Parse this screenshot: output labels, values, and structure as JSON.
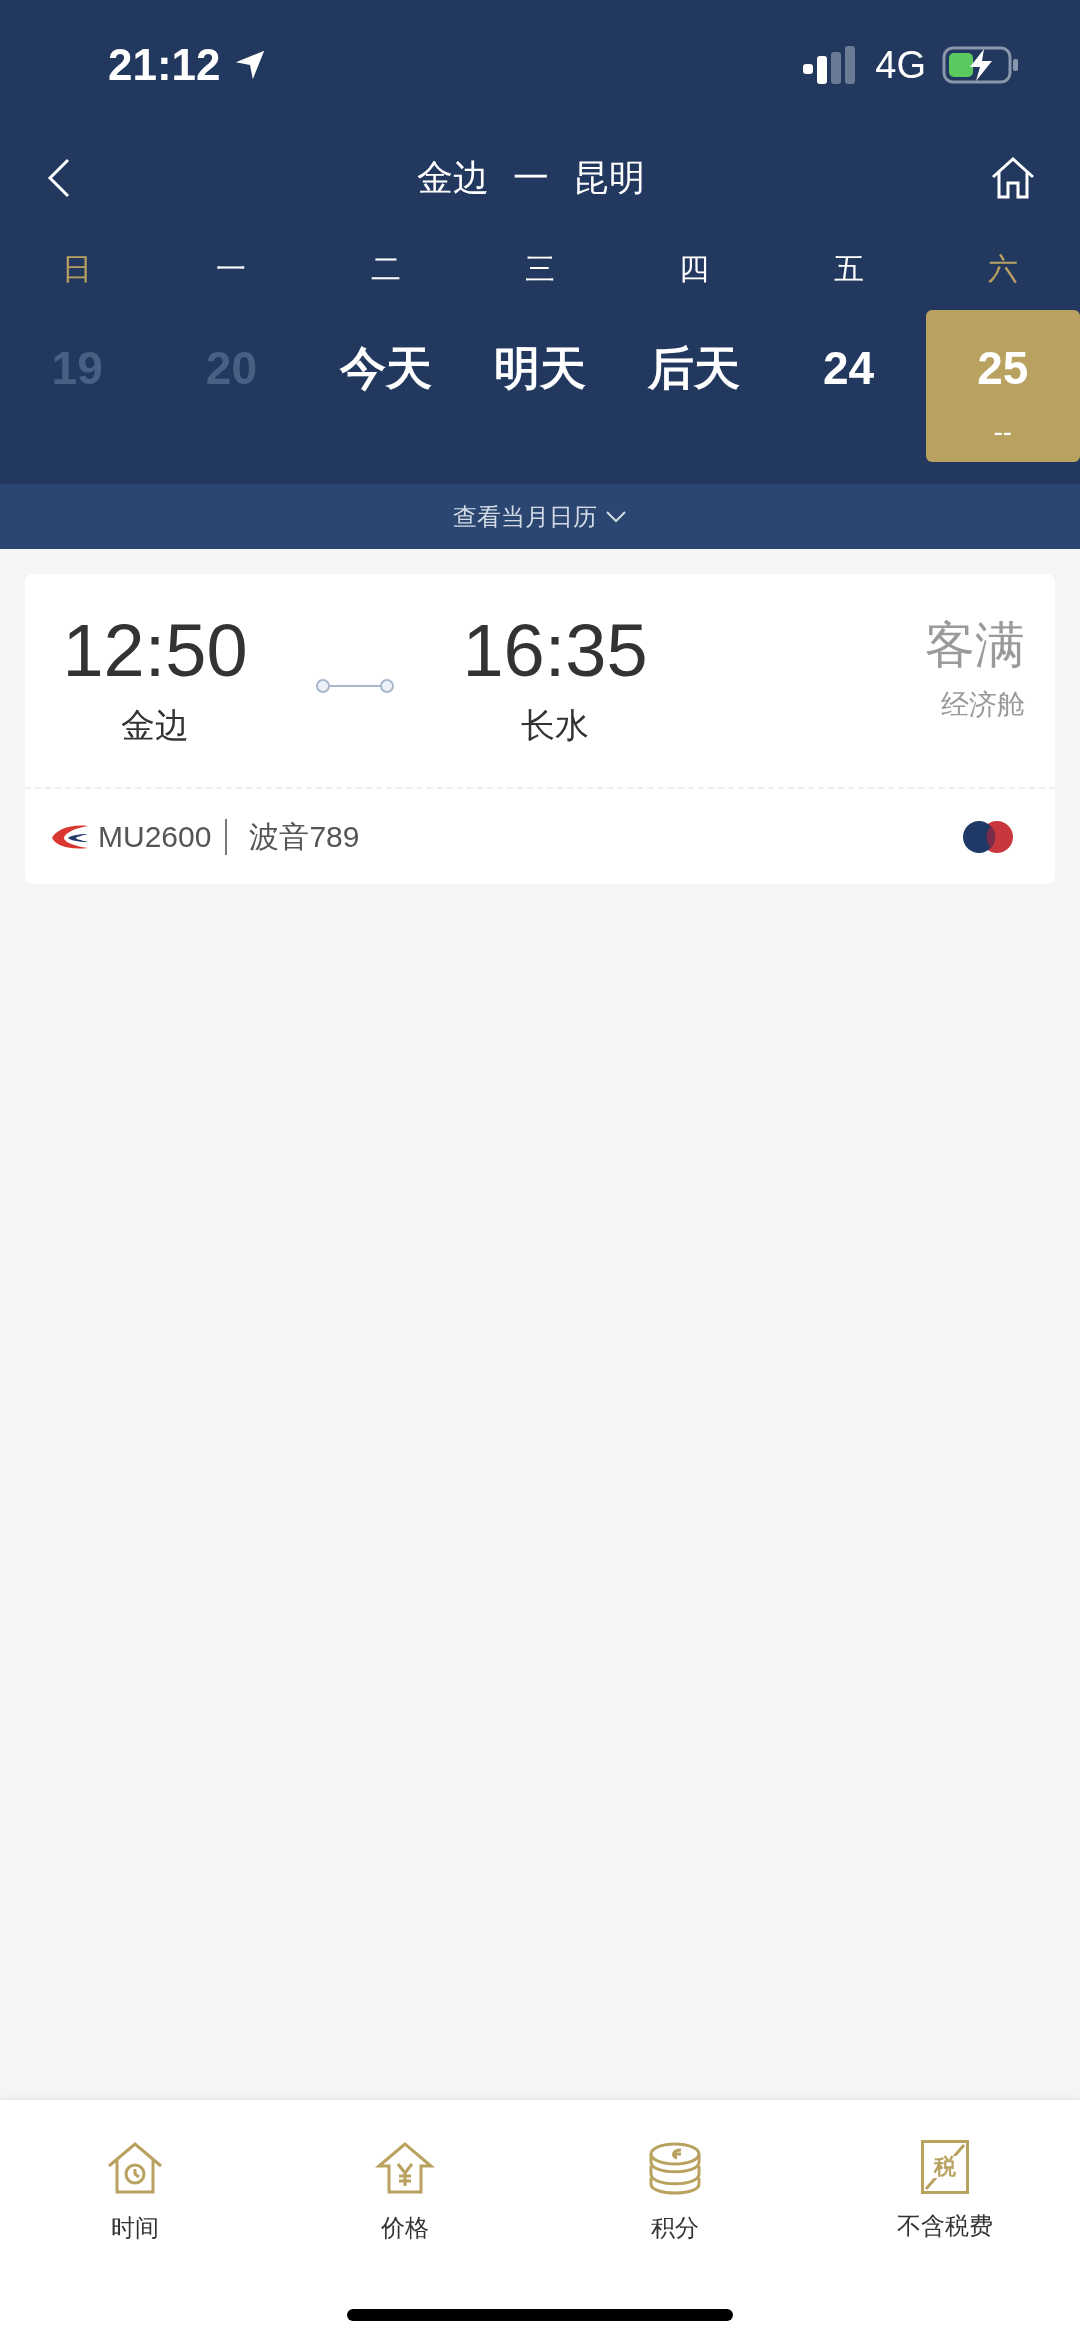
{
  "status_bar": {
    "time": "21:12",
    "network": "4G"
  },
  "header": {
    "title_from": "金边",
    "title_sep": "一",
    "title_to": "昆明"
  },
  "days": [
    {
      "weekday": "日",
      "weekend": true,
      "label": "19",
      "past": true,
      "selected": false
    },
    {
      "weekday": "一",
      "weekend": false,
      "label": "20",
      "past": true,
      "selected": false
    },
    {
      "weekday": "二",
      "weekend": false,
      "label": "今天",
      "past": false,
      "selected": false
    },
    {
      "weekday": "三",
      "weekend": false,
      "label": "明天",
      "past": false,
      "selected": false
    },
    {
      "weekday": "四",
      "weekend": false,
      "label": "后天",
      "past": false,
      "selected": false
    },
    {
      "weekday": "五",
      "weekend": false,
      "label": "24",
      "past": false,
      "selected": false
    },
    {
      "weekday": "六",
      "weekend": true,
      "label": "25",
      "past": false,
      "selected": true,
      "price": "--"
    }
  ],
  "calendar_link": "查看当月日历",
  "flights": [
    {
      "depart_time": "12:50",
      "depart_airport": "金边",
      "arrive_time": "16:35",
      "arrive_airport": "长水",
      "status": "客满",
      "cabin": "经济舱",
      "flight_no": "MU2600",
      "aircraft": "波音789"
    }
  ],
  "bottom_bar": [
    {
      "kind": "time",
      "label": "时间"
    },
    {
      "kind": "price",
      "label": "价格"
    },
    {
      "kind": "points",
      "label": "积分"
    },
    {
      "kind": "tax",
      "label": "不含税费",
      "glyph": "税"
    }
  ]
}
